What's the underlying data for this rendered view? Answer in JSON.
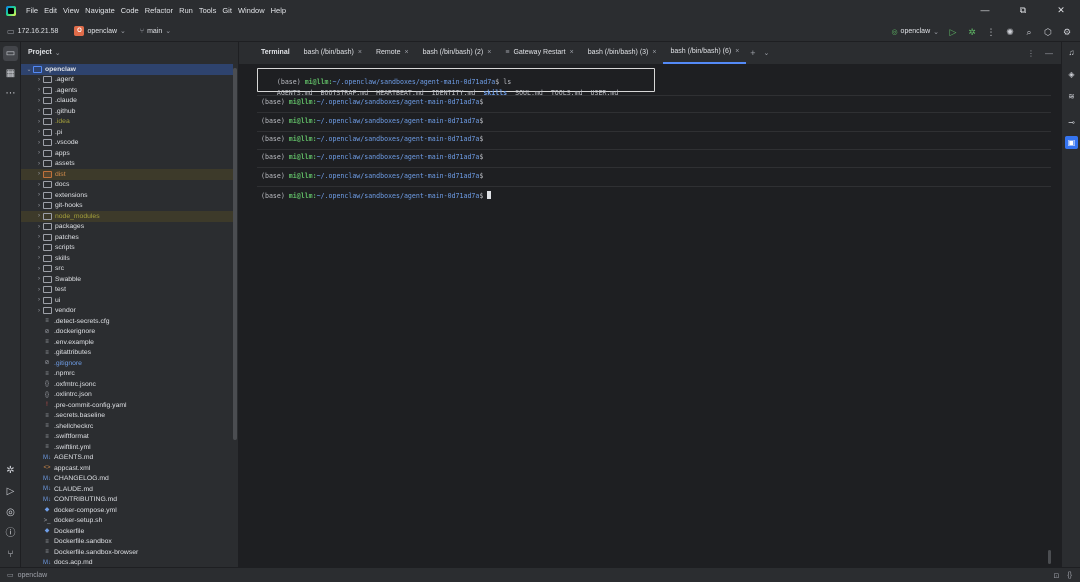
{
  "menu": [
    "File",
    "Edit",
    "View",
    "Navigate",
    "Code",
    "Refactor",
    "Run",
    "Tools",
    "Git",
    "Window",
    "Help"
  ],
  "toolbar": {
    "host": "172.16.21.58",
    "project_badge": "O",
    "project": "openclaw",
    "branch": "main",
    "run_config": "openclaw"
  },
  "project_panel": {
    "title": "Project",
    "tree": [
      {
        "name": "openclaw",
        "type": "root",
        "depth": 0,
        "expanded": true
      },
      {
        "name": ".agent",
        "type": "folder",
        "depth": 1
      },
      {
        "name": ".agents",
        "type": "folder",
        "depth": 1
      },
      {
        "name": ".claude",
        "type": "folder",
        "depth": 1
      },
      {
        "name": ".github",
        "type": "folder",
        "depth": 1
      },
      {
        "name": ".idea",
        "type": "folder",
        "depth": 1,
        "color": "olive"
      },
      {
        "name": ".pi",
        "type": "folder",
        "depth": 1
      },
      {
        "name": ".vscode",
        "type": "folder",
        "depth": 1
      },
      {
        "name": "apps",
        "type": "folder",
        "depth": 1
      },
      {
        "name": "assets",
        "type": "folder",
        "depth": 1
      },
      {
        "name": "dist",
        "type": "folder-excluded",
        "depth": 1,
        "color": "orange"
      },
      {
        "name": "docs",
        "type": "folder",
        "depth": 1
      },
      {
        "name": "extensions",
        "type": "folder",
        "depth": 1
      },
      {
        "name": "git-hooks",
        "type": "folder",
        "depth": 1
      },
      {
        "name": "node_modules",
        "type": "folder-excluded",
        "depth": 1,
        "color": "olive"
      },
      {
        "name": "packages",
        "type": "folder",
        "depth": 1
      },
      {
        "name": "patches",
        "type": "folder",
        "depth": 1
      },
      {
        "name": "scripts",
        "type": "folder",
        "depth": 1
      },
      {
        "name": "skills",
        "type": "folder",
        "depth": 1
      },
      {
        "name": "src",
        "type": "folder",
        "depth": 1
      },
      {
        "name": "Swabble",
        "type": "folder",
        "depth": 1
      },
      {
        "name": "test",
        "type": "folder",
        "depth": 1
      },
      {
        "name": "ui",
        "type": "folder",
        "depth": 1
      },
      {
        "name": "vendor",
        "type": "folder",
        "depth": 1
      },
      {
        "name": ".detect-secrets.cfg",
        "type": "file",
        "depth": 1,
        "icon": "≡"
      },
      {
        "name": ".dockerignore",
        "type": "file",
        "depth": 1,
        "icon": "⊘"
      },
      {
        "name": ".env.example",
        "type": "file",
        "depth": 1,
        "icon": "≡"
      },
      {
        "name": ".gitattributes",
        "type": "file",
        "depth": 1,
        "icon": "≡"
      },
      {
        "name": ".gitignore",
        "type": "file",
        "depth": 1,
        "icon": "⊘",
        "color": "blue"
      },
      {
        "name": ".npmrc",
        "type": "file",
        "depth": 1,
        "icon": "≡"
      },
      {
        "name": ".oxfmtrc.jsonc",
        "type": "file",
        "depth": 1,
        "icon": "{}"
      },
      {
        "name": ".oxlintrc.json",
        "type": "file",
        "depth": 1,
        "icon": "{}"
      },
      {
        "name": ".pre-commit-config.yaml",
        "type": "file",
        "depth": 1,
        "icon": "!",
        "icon_color": "red"
      },
      {
        "name": ".secrets.baseline",
        "type": "file",
        "depth": 1,
        "icon": "≡"
      },
      {
        "name": ".shellcheckrc",
        "type": "file",
        "depth": 1,
        "icon": "≡"
      },
      {
        "name": ".swiftformat",
        "type": "file",
        "depth": 1,
        "icon": "≡"
      },
      {
        "name": ".swiftlint.yml",
        "type": "file",
        "depth": 1,
        "icon": "≡"
      },
      {
        "name": "AGENTS.md",
        "type": "file",
        "depth": 1,
        "icon": "M↓",
        "icon_color": "blue"
      },
      {
        "name": "appcast.xml",
        "type": "file",
        "depth": 1,
        "icon": "<>",
        "icon_color": "orange"
      },
      {
        "name": "CHANGELOG.md",
        "type": "file",
        "depth": 1,
        "icon": "M↓",
        "icon_color": "blue"
      },
      {
        "name": "CLAUDE.md",
        "type": "file",
        "depth": 1,
        "icon": "M↓",
        "icon_color": "blue"
      },
      {
        "name": "CONTRIBUTING.md",
        "type": "file",
        "depth": 1,
        "icon": "M↓",
        "icon_color": "blue"
      },
      {
        "name": "docker-compose.yml",
        "type": "file",
        "depth": 1,
        "icon": "◆",
        "icon_color": "blue"
      },
      {
        "name": "docker-setup.sh",
        "type": "file",
        "depth": 1,
        "icon": ">_"
      },
      {
        "name": "Dockerfile",
        "type": "file",
        "depth": 1,
        "icon": "◆",
        "icon_color": "blue"
      },
      {
        "name": "Dockerfile.sandbox",
        "type": "file",
        "depth": 1,
        "icon": "≡"
      },
      {
        "name": "Dockerfile.sandbox-browser",
        "type": "file",
        "depth": 1,
        "icon": "≡"
      },
      {
        "name": "docs.acp.md",
        "type": "file",
        "depth": 1,
        "icon": "M↓",
        "icon_color": "blue"
      }
    ]
  },
  "terminal": {
    "panel_title": "Terminal",
    "tabs": [
      {
        "label": "bash (/bin/bash)",
        "active": false
      },
      {
        "label": "Remote",
        "active": false
      },
      {
        "label": "bash (/bin/bash) (2)",
        "active": false
      },
      {
        "label": "Gateway Restart",
        "active": false,
        "icon": "≡"
      },
      {
        "label": "bash (/bin/bash) (3)",
        "active": false
      },
      {
        "label": "bash (/bin/bash) (6)",
        "active": true
      }
    ],
    "prompt": {
      "env": "(base) ",
      "user": "mi@llm",
      "sep": ":",
      "path": "~/.openclaw/sandboxes/agent-main-0d71ad7a",
      "symbol": "$"
    },
    "command": " ls",
    "ls_output": {
      "files_before": "AGENTS.md  BOOTSTRAP.md  HEARTBEAT.md  IDENTITY.md  ",
      "dir": "skills",
      "files_after": "  SOUL.md  TOOLS.md  USER.md"
    }
  },
  "status_bar": {
    "breadcrumb": "openclaw"
  }
}
